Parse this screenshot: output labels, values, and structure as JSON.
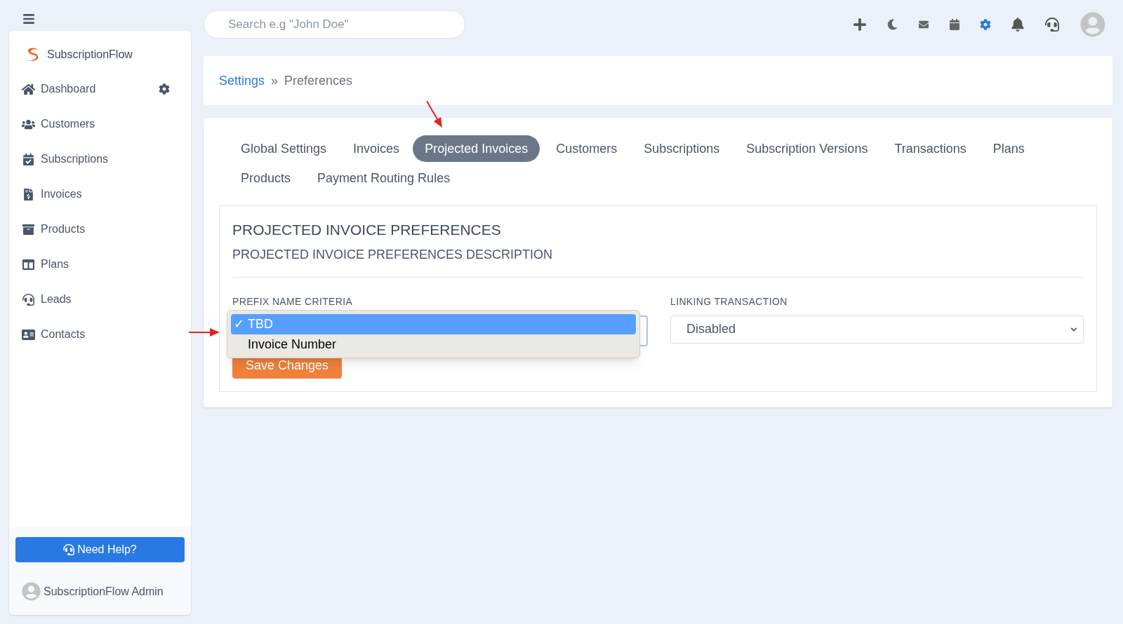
{
  "topbar": {
    "search": {
      "placeholder": "Search e.g \"John Doe\""
    }
  },
  "sidebar": {
    "brand": "SubscriptionFlow",
    "items": [
      {
        "label": "Dashboard"
      },
      {
        "label": "Customers"
      },
      {
        "label": "Subscriptions"
      },
      {
        "label": "Invoices"
      },
      {
        "label": "Products"
      },
      {
        "label": "Plans"
      },
      {
        "label": "Leads"
      },
      {
        "label": "Contacts"
      }
    ],
    "help_button": "Need Help?",
    "user": "SubscriptionFlow Admin"
  },
  "breadcrumb": {
    "items": [
      "Settings",
      "Preferences"
    ],
    "separator": "»"
  },
  "tabs": [
    {
      "label": "Global Settings",
      "selected": false
    },
    {
      "label": "Invoices",
      "selected": false
    },
    {
      "label": "Projected Invoices",
      "selected": true
    },
    {
      "label": "Customers",
      "selected": false
    },
    {
      "label": "Subscriptions",
      "selected": false
    },
    {
      "label": "Subscription Versions",
      "selected": false
    },
    {
      "label": "Transactions",
      "selected": false
    },
    {
      "label": "Plans",
      "selected": false
    },
    {
      "label": "Products",
      "selected": false
    },
    {
      "label": "Payment Routing Rules",
      "selected": false
    }
  ],
  "section": {
    "title": "PROJECTED INVOICE PREFERENCES",
    "description": "PROJECTED INVOICE PREFERENCES DESCRIPTION",
    "prefix_field": {
      "label": "PREFIX NAME CRITERIA",
      "options": [
        {
          "label": "TBD",
          "selected": true
        },
        {
          "label": "Invoice Number",
          "selected": false
        }
      ],
      "check": "✓"
    },
    "linking_field": {
      "label": "LINKING TRANSACTION",
      "value": "Disabled"
    },
    "save_button": "Save Changes"
  }
}
